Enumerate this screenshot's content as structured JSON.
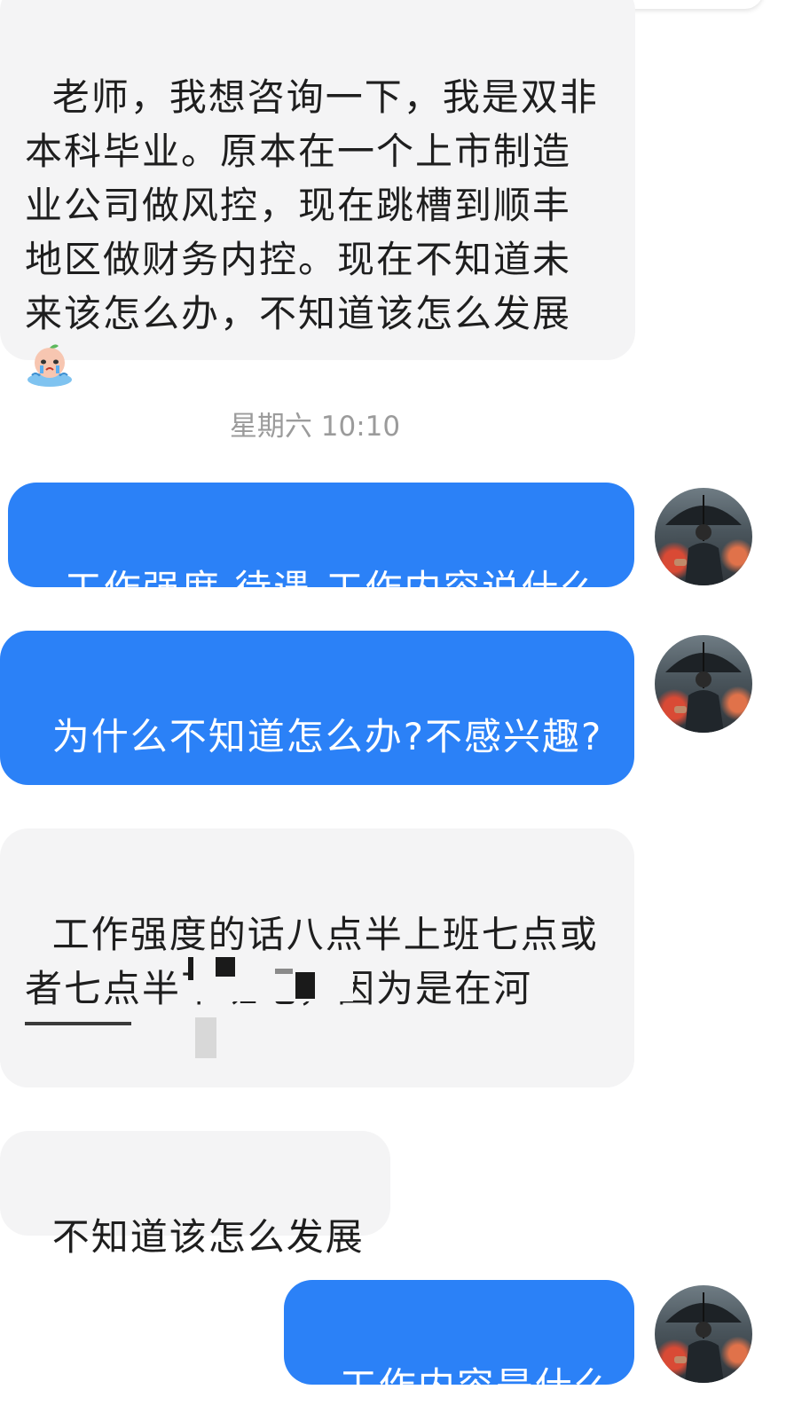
{
  "messages": [
    {
      "side": "in",
      "text": "老师，我想咨询一下，我是双非本科毕业。原本在一个上市制造业公司做风控，现在跳槽到顺丰地区做财务内控。现在不知道未来该怎么办，不知道该怎么发展"
    },
    {
      "side": "time",
      "text": "星期六 10:10"
    },
    {
      "side": "out",
      "text": "工作强度 待遇 工作内容说什么"
    },
    {
      "side": "out",
      "text": "为什么不知道怎么办?不感兴趣?"
    },
    {
      "side": "in",
      "text": "工作强度的话八点半上班七点或者七点半下班吧，因为是在河北，在  算是比较不错的一年"
    },
    {
      "side": "in",
      "text": "不知道该怎么发展"
    },
    {
      "side": "out",
      "text": "工作内容是什么"
    }
  ],
  "emoji_names": [
    "crying-peach-emoji"
  ],
  "colors": {
    "outgoing_bubble": "#2b81f7",
    "incoming_bubble": "#f4f4f5",
    "timestamp": "#9b9b9b"
  },
  "avatar_icon": "man-with-umbrella-avatar"
}
